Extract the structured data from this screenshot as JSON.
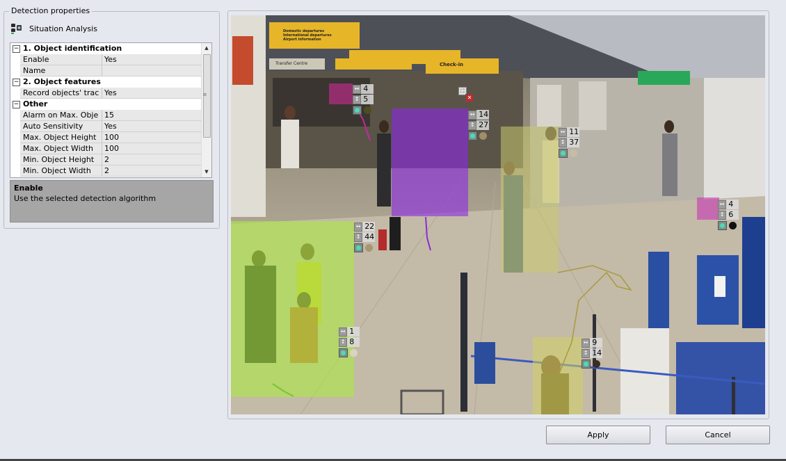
{
  "panel": {
    "title": "Detection properties",
    "algorithm": "Situation Analysis",
    "categories": [
      {
        "label": "1. Object identification"
      },
      {
        "label": "2. Object features"
      },
      {
        "label": "Other"
      }
    ],
    "properties": [
      {
        "name": "Enable",
        "value": "Yes"
      },
      {
        "name": "Name",
        "value": ""
      },
      {
        "name": "Record objects' trac",
        "value": "Yes"
      },
      {
        "name": "Alarm on Max. Obje",
        "value": "15"
      },
      {
        "name": "Auto Sensitivity",
        "value": "Yes"
      },
      {
        "name": "Max. Object Height",
        "value": "100"
      },
      {
        "name": "Max. Object Width",
        "value": "100"
      },
      {
        "name": "Min. Object Height",
        "value": "2"
      },
      {
        "name": "Min. Object Width",
        "value": "2"
      }
    ],
    "help": {
      "title": "Enable",
      "text": "Use the selected detection algorithm"
    }
  },
  "video": {
    "signs": {
      "s1a": "Domestic departures",
      "s1b": "International departures",
      "s1c": "Airport information",
      "s2": "Transfer Centre",
      "s3": "Check-in"
    },
    "detections": [
      {
        "w": "4",
        "h": "5",
        "color": "#4f4d20"
      },
      {
        "w": "14",
        "h": "27",
        "color": "#a08e68"
      },
      {
        "w": "11",
        "h": "37",
        "color": "#c8bca5"
      },
      {
        "w": "4",
        "h": "6",
        "color": "#111111"
      },
      {
        "w": "22",
        "h": "44",
        "color": "#a89572"
      },
      {
        "w": "1",
        "h": "8",
        "color": "#d9d4c1"
      },
      {
        "w": "9",
        "h": "14",
        "color": "#3a2e24"
      }
    ]
  },
  "buttons": {
    "apply": "Apply",
    "cancel": "Cancel"
  }
}
